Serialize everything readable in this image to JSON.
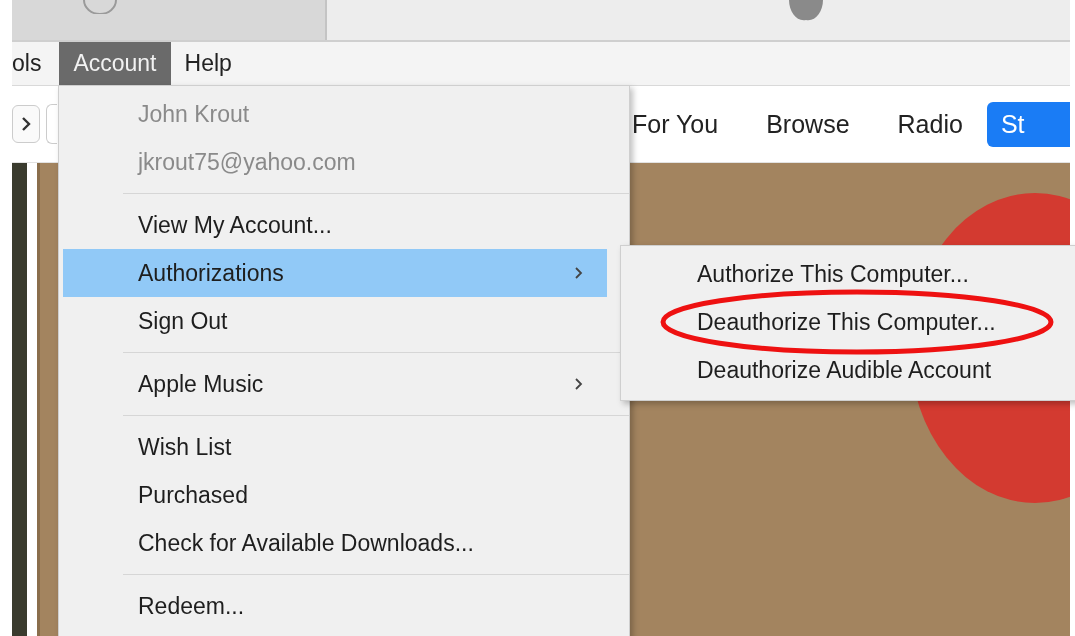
{
  "menu_bar": [
    {
      "label": "ols",
      "selected": false
    },
    {
      "label": "Account",
      "selected": true
    },
    {
      "label": "Help",
      "selected": false
    }
  ],
  "nav_tabs": [
    {
      "label": "For You",
      "selected": false
    },
    {
      "label": "Browse",
      "selected": false
    },
    {
      "label": "Radio",
      "selected": false
    },
    {
      "label": "St",
      "selected": true
    }
  ],
  "account_menu": [
    {
      "kind": "item",
      "label": "John Krout",
      "disabled": true,
      "selected": false,
      "has_submenu": false
    },
    {
      "kind": "item",
      "label": "jkrout75@yahoo.com",
      "disabled": true,
      "selected": false,
      "has_submenu": false
    },
    {
      "kind": "separator"
    },
    {
      "kind": "item",
      "label": "View My Account...",
      "disabled": false,
      "selected": false,
      "has_submenu": false
    },
    {
      "kind": "item",
      "label": "Authorizations",
      "disabled": false,
      "selected": true,
      "has_submenu": true
    },
    {
      "kind": "item",
      "label": "Sign Out",
      "disabled": false,
      "selected": false,
      "has_submenu": false
    },
    {
      "kind": "separator"
    },
    {
      "kind": "item",
      "label": "Apple Music",
      "disabled": false,
      "selected": false,
      "has_submenu": true
    },
    {
      "kind": "separator"
    },
    {
      "kind": "item",
      "label": "Wish List",
      "disabled": false,
      "selected": false,
      "has_submenu": false
    },
    {
      "kind": "item",
      "label": "Purchased",
      "disabled": false,
      "selected": false,
      "has_submenu": false
    },
    {
      "kind": "item",
      "label": "Check for Available Downloads...",
      "disabled": false,
      "selected": false,
      "has_submenu": false
    },
    {
      "kind": "separator"
    },
    {
      "kind": "item",
      "label": "Redeem...",
      "disabled": false,
      "selected": false,
      "has_submenu": false
    }
  ],
  "authorizations_submenu": [
    {
      "label": "Authorize This Computer...",
      "selected": false,
      "circled": false
    },
    {
      "label": "Deauthorize This Computer...",
      "selected": false,
      "circled": true
    },
    {
      "label": "Deauthorize Audible Account",
      "selected": false,
      "circled": false
    }
  ]
}
